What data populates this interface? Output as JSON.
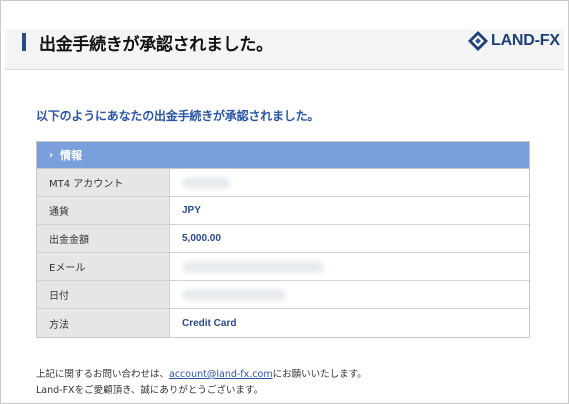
{
  "header": {
    "title": "出金手続きが承認されました。",
    "logo": {
      "text_main": "LAND",
      "text_dash": "-",
      "text_fx": "FX",
      "colors": {
        "navy": "#1f3f7a",
        "accent": "#2a55a6"
      }
    }
  },
  "message": {
    "headline": "以下のようにあなたの出金手続きが承認されました。"
  },
  "info": {
    "section_title": "情報",
    "chevron_icon": "›",
    "rows": [
      {
        "label": "MT4 アカウント",
        "value": ""
      },
      {
        "label": "通貨",
        "value": "JPY"
      },
      {
        "label": "出金金額",
        "value": "5,000.00"
      },
      {
        "label": "Eメール",
        "value": ""
      },
      {
        "label": "日付",
        "value": ""
      },
      {
        "label": "方法",
        "value": "Credit Card"
      }
    ]
  },
  "footer": {
    "line1_prefix": "上記に関するお問い合わせは、",
    "email_link": "account@land-fx.com",
    "line1_suffix": "にお願いいたします。",
    "line2": "Land-FXをご愛顧頂き、誠にありがとうございます。"
  }
}
